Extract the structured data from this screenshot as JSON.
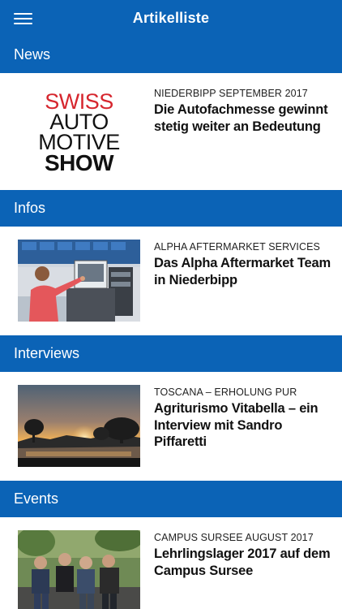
{
  "header": {
    "title": "Artikelliste",
    "menu_icon": "hamburger-menu-icon"
  },
  "sections": [
    {
      "name": "News",
      "article": {
        "kicker": "NIEDERBIPP SEPTEMBER 2017",
        "headline": "Die Autofachmesse gewinnt stetig weiter an Bedeutung",
        "logo_lines": [
          "SWISS",
          "AUTO",
          "MOTIVE",
          "SHOW"
        ]
      }
    },
    {
      "name": "Infos",
      "article": {
        "kicker": "ALPHA AFTERMARKET SERVICES",
        "headline": "Das Alpha Aftermarket Team in Niederbipp"
      }
    },
    {
      "name": "Interviews",
      "article": {
        "kicker": "TOSCANA – ERHOLUNG PUR",
        "headline": "Agriturismo Vitabella – ein Interview mit Sandro Piffaretti"
      }
    },
    {
      "name": "Events",
      "article": {
        "kicker": "CAMPUS SURSEE AUGUST 2017",
        "headline": "Lehrlingslager 2017 auf dem Campus Sursee"
      }
    }
  ],
  "colors": {
    "primary": "#0b63b6",
    "logo_red": "#d6262e"
  }
}
